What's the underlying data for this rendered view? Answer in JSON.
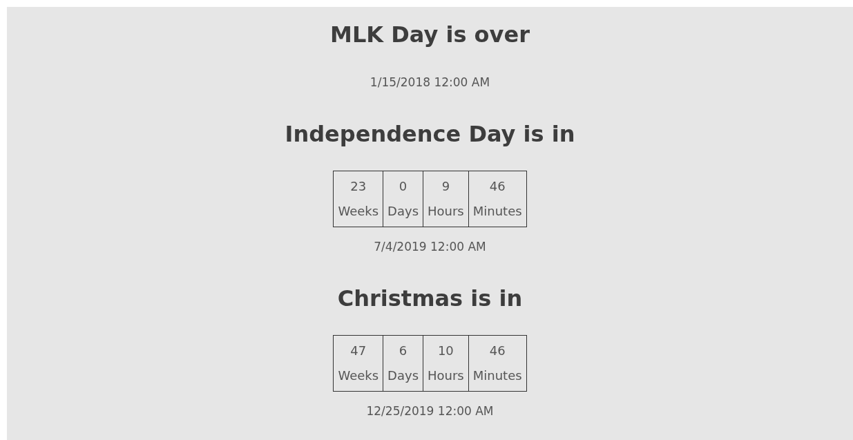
{
  "events": [
    {
      "kind": "over",
      "title": "MLK Day is over",
      "date": "1/15/2018 12:00 AM"
    },
    {
      "kind": "countdown",
      "title": "Independence Day is in",
      "countdown": [
        {
          "value": "23",
          "unit": "Weeks"
        },
        {
          "value": "0",
          "unit": "Days"
        },
        {
          "value": "9",
          "unit": "Hours"
        },
        {
          "value": "46",
          "unit": "Minutes"
        }
      ],
      "date": "7/4/2019 12:00 AM"
    },
    {
      "kind": "countdown",
      "title": "Christmas is in",
      "countdown": [
        {
          "value": "47",
          "unit": "Weeks"
        },
        {
          "value": "6",
          "unit": "Days"
        },
        {
          "value": "10",
          "unit": "Hours"
        },
        {
          "value": "46",
          "unit": "Minutes"
        }
      ],
      "date": "12/25/2019 12:00 AM"
    }
  ]
}
